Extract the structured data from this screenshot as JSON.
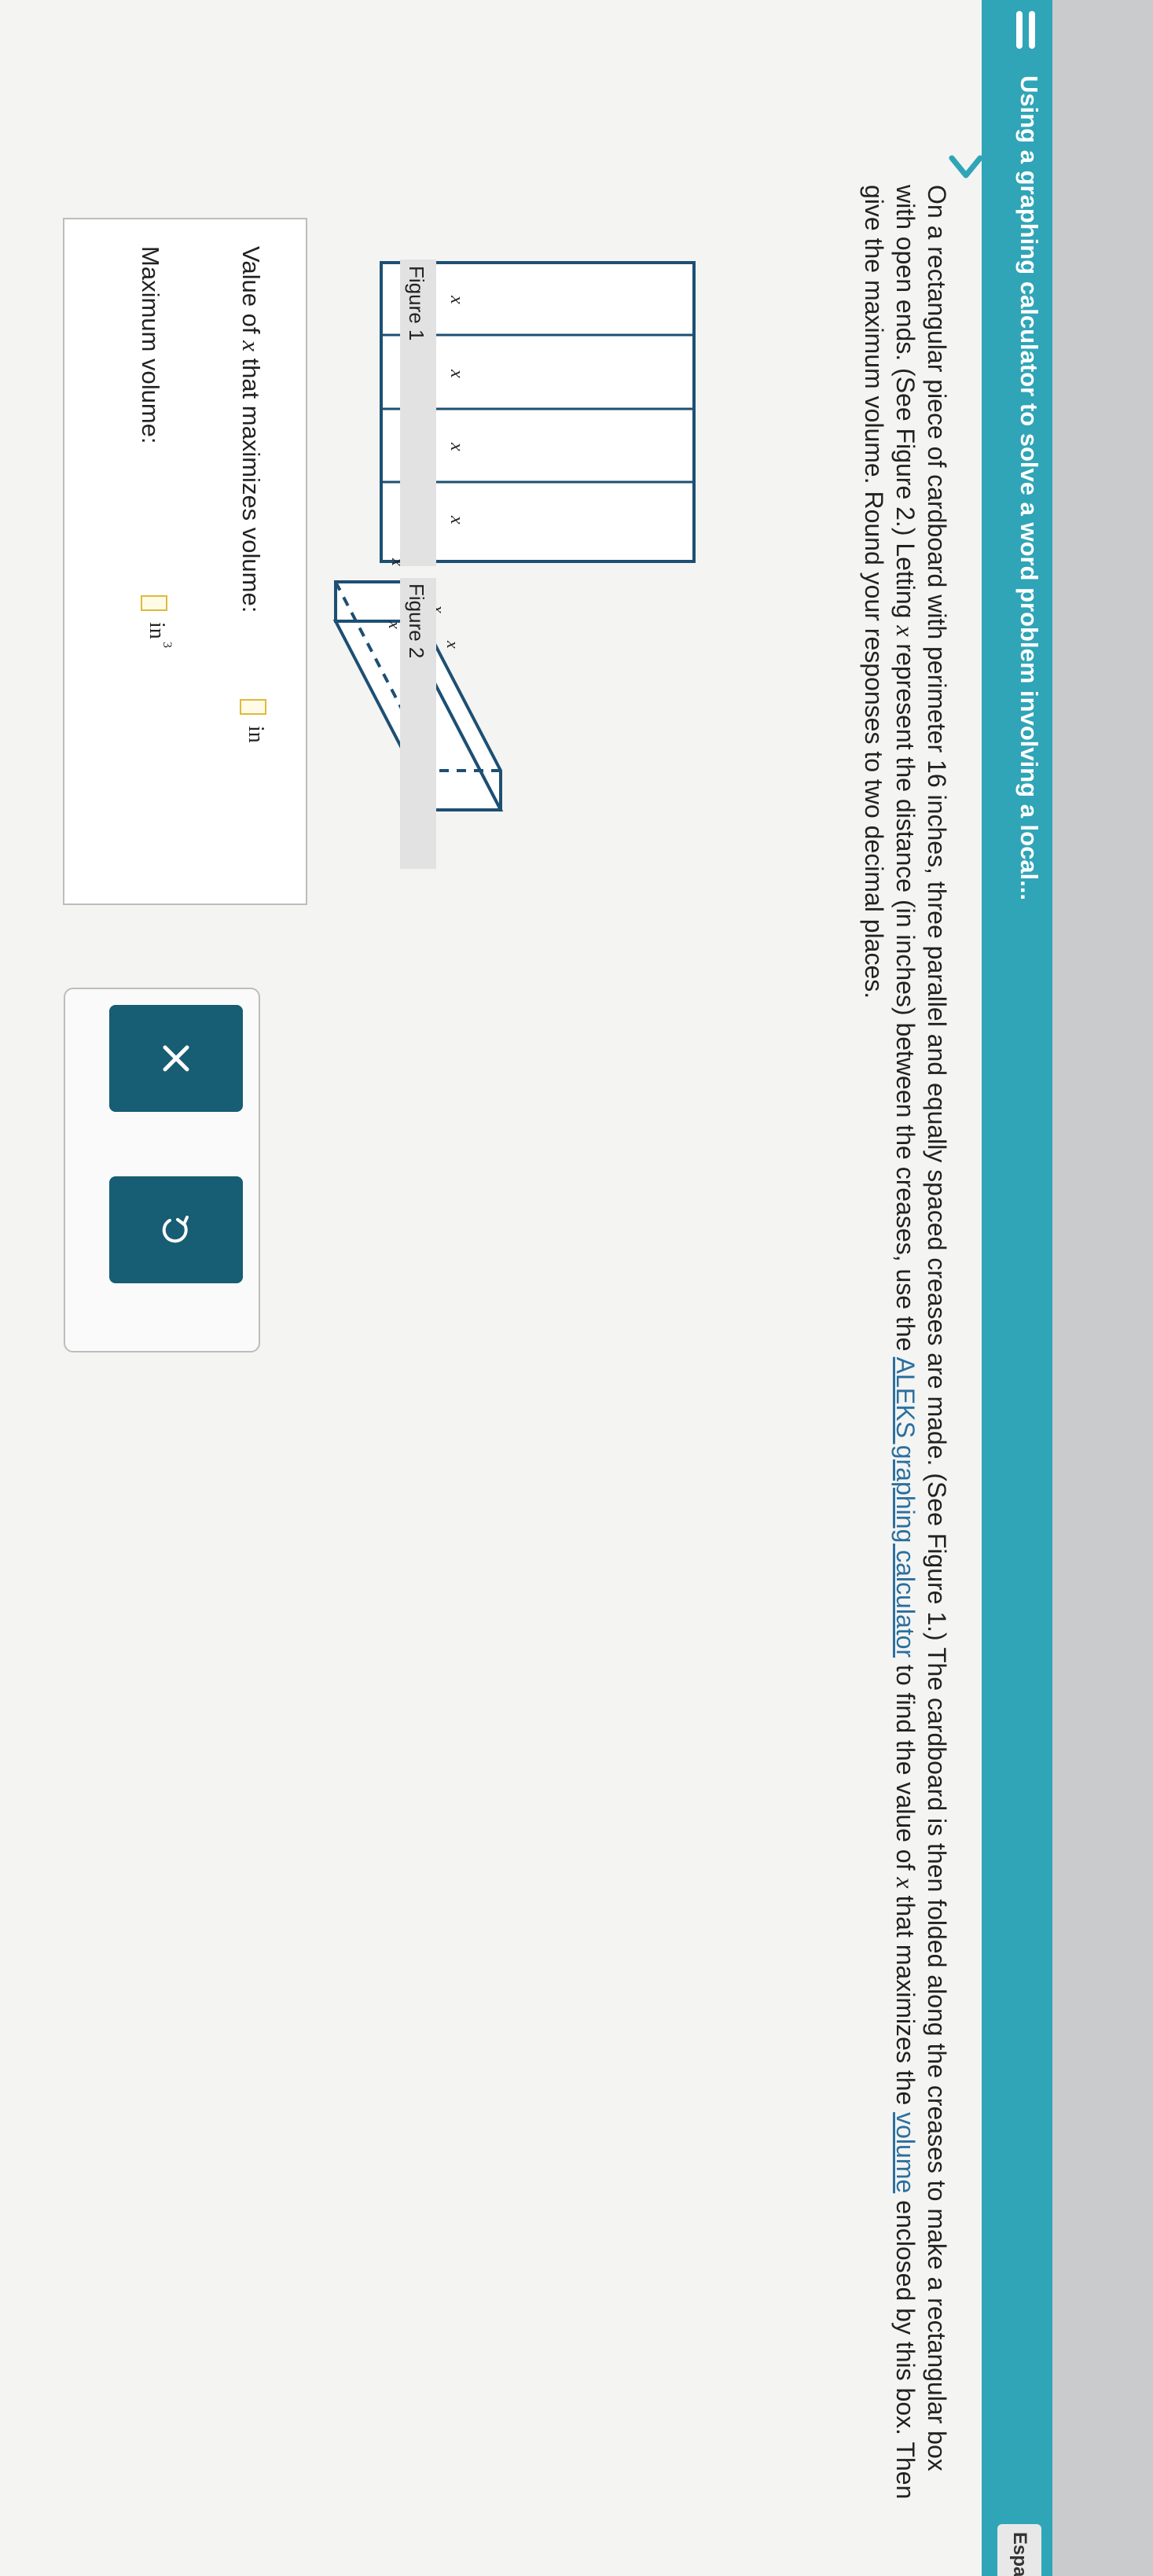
{
  "header": {
    "title": "Using a graphing calculator to solve a word problem involving a local...",
    "language_button": "Espa"
  },
  "question": {
    "part1": "On a rectangular piece of cardboard with perimeter 16 inches, three parallel and equally spaced creases are made. (See Figure 1.) The cardboard is then folded along the creases to make a rectangular box with open ends. (See Figure 2.) Letting ",
    "var1": "x",
    "part2": " represent the distance (in inches) between the creases, use the ",
    "link_aleks": "ALEKS graphing calculator",
    "part3": " to find the value of ",
    "var2": "x",
    "part4": " that maximizes the ",
    "link_volume": "volume",
    "part5": " enclosed by this box. Then give the maximum volume. Round your responses to two decimal places."
  },
  "figure1": {
    "label": "Figure 1",
    "x_labels": [
      "x",
      "x",
      "x",
      "x"
    ]
  },
  "figure2": {
    "label": "Figure 2",
    "x_labels": [
      "x",
      "x",
      "x",
      "x"
    ]
  },
  "answers": {
    "value_label_prefix": "Value of ",
    "value_label_var": "x",
    "value_label_suffix": " that maximizes volume:",
    "value_unit": "in",
    "max_label": "Maximum volume:",
    "max_unit": "in",
    "max_unit_exponent": "3"
  },
  "actions": {
    "clear_icon": "x-icon",
    "undo_icon": "undo-icon"
  },
  "colors": {
    "header_strip": "#2fa5b7",
    "action_button": "#175d73",
    "input_border": "#e0b93a"
  }
}
